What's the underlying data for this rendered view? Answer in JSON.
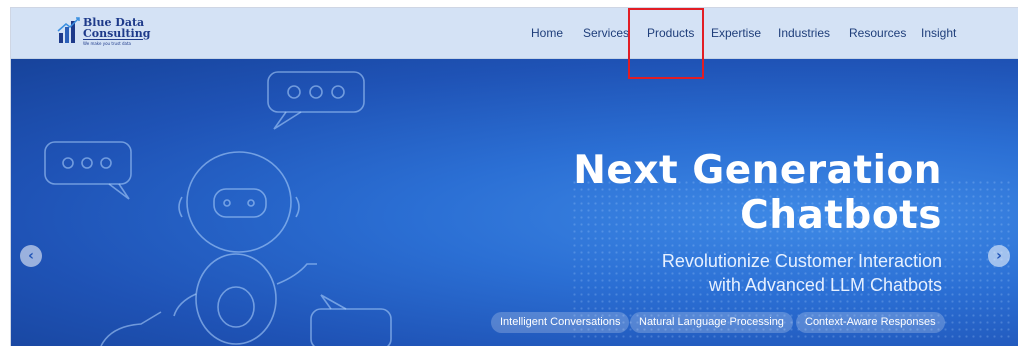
{
  "brand": {
    "name_line1": "Blue Data",
    "name_line2": "Consulting",
    "tagline": "We make you trust data"
  },
  "nav": {
    "items": [
      {
        "label": "Home"
      },
      {
        "label": "Services"
      },
      {
        "label": "Products"
      },
      {
        "label": "Expertise"
      },
      {
        "label": "Industries"
      },
      {
        "label": "Resources"
      },
      {
        "label": "Insight"
      }
    ],
    "highlighted": "Products"
  },
  "hero": {
    "headline_line1": "Next Generation",
    "headline_line2": "Chatbots",
    "subheadline_line1": "Revolutionize Customer Interaction",
    "subheadline_line2": "with Advanced LLM Chatbots",
    "features": [
      "Intelligent Conversations",
      "Natural Language Processing",
      "Context-Aware Responses"
    ],
    "prev_icon": "‹",
    "next_icon": "›"
  },
  "colors": {
    "nav_bg": "#d4e2f5",
    "nav_text": "#1f3e7a",
    "hero_bg": "#2b6fd4",
    "highlight": "#e21d24"
  }
}
